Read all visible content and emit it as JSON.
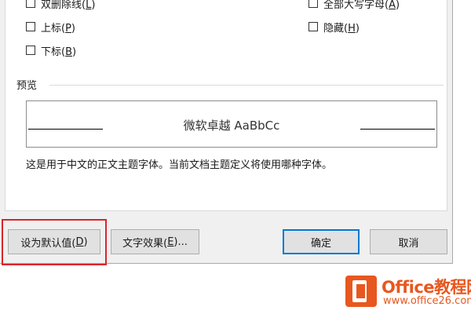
{
  "effects": {
    "double_strikethrough": {
      "label": "双删除线(",
      "key": "L",
      "end": ")"
    },
    "superscript": {
      "label": "上标(",
      "key": "P",
      "end": ")"
    },
    "subscript": {
      "label": "下标(",
      "key": "B",
      "end": ")"
    },
    "all_caps": {
      "label": "全部大写字母(",
      "key": "A",
      "end": ")"
    },
    "hidden": {
      "label": "隐藏(",
      "key": "H",
      "end": ")"
    }
  },
  "preview": {
    "section_title": "预览",
    "sample_text": "微软卓越  AaBbCc",
    "description": "这是用于中文的正文主题字体。当前文档主题定义将使用哪种字体。"
  },
  "buttons": {
    "set_default": {
      "label": "设为默认值(",
      "key": "D",
      "end": ")"
    },
    "text_effects": {
      "label": "文字效果(",
      "key": "E",
      "end": ")..."
    },
    "ok": "确定",
    "cancel": "取消"
  },
  "watermark": {
    "title": "Office教程网",
    "url": "www.office26.com"
  },
  "colors": {
    "highlight": "#d9252b",
    "primary_button_border": "#0078d7",
    "brand_orange": "#e8571f"
  }
}
